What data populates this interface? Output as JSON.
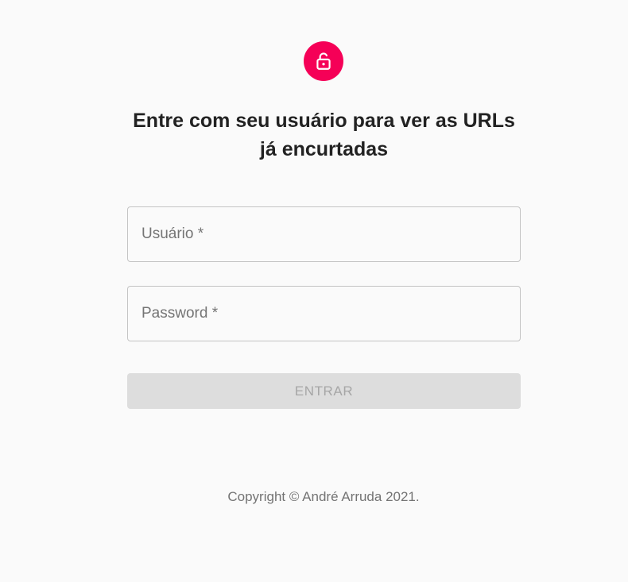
{
  "icon": {
    "name": "lock-icon",
    "background": "#f50057",
    "color": "#ffffff"
  },
  "header": {
    "title": "Entre com seu usuário para ver as URLs já encurtadas"
  },
  "form": {
    "username": {
      "label": "Usuário *",
      "value": ""
    },
    "password": {
      "label": "Password *",
      "value": ""
    },
    "submit_label": "ENTRAR",
    "submit_disabled": true
  },
  "footer": {
    "copyright": "Copyright © André Arruda 2021."
  }
}
